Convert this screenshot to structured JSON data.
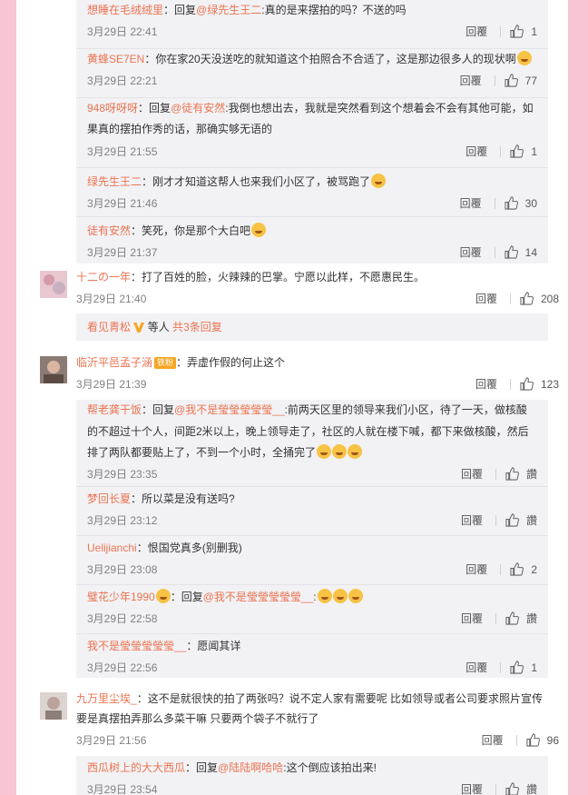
{
  "colors": {
    "accent": "#eb7350",
    "background": "#f7c5d4",
    "sub_bg": "#f2f2f5"
  },
  "icons": {
    "like": "thumbs-up-icon",
    "emoji": "emoji-face-icon",
    "vip": "vip-v-icon"
  },
  "block1": {
    "subs": [
      {
        "name": "想睡在毛绒绒里",
        "sep": "：",
        "prefix": "回复",
        "mention": "@绿先生王二",
        "body": ":真的是来摆拍的吗？不送的吗",
        "emoji": "",
        "time": "3月29日 22:41",
        "reply": "回覆",
        "likes": "1"
      },
      {
        "name": "黄蜂SE7EN",
        "sep": "：",
        "prefix": "",
        "mention": "",
        "body": "你在家20天没送吃的就知道这个拍照合不合适了，这是那边很多人的现状啊",
        "emoji": "emoji-face",
        "time": "3月29日 22:21",
        "reply": "回覆",
        "likes": "77"
      },
      {
        "name": "948呀呀呀",
        "sep": "：",
        "prefix": "回复",
        "mention": "@徒有安然",
        "body": ":我倒也想出去，我就是突然看到这个想着会不会有其他可能，如",
        "body2": "果真的摆拍作秀的话，那确实够无语的",
        "emoji": "",
        "time": "3月29日 21:55",
        "reply": "回覆",
        "likes": "1"
      },
      {
        "name": "绿先生王二",
        "sep": "：",
        "prefix": "",
        "mention": "",
        "body": "刚才才知道这帮人也来我们小区了，被骂跑了",
        "emoji": "emoji-face",
        "time": "3月29日 21:46",
        "reply": "回覆",
        "likes": "30"
      },
      {
        "name": "徒有安然",
        "sep": "：",
        "prefix": "",
        "mention": "",
        "body": "笑死，你是那个大白吧",
        "emoji": "emoji-face",
        "time": "3月29日 21:37",
        "reply": "回覆",
        "likes": "14"
      }
    ]
  },
  "comment1": {
    "name": "十二の一年",
    "sep": "：",
    "body": "打了百姓的脸，火辣辣的巴掌。宁愿以此样，不愿惠民生。",
    "time": "3月29日 21:40",
    "reply": "回覆",
    "likes": "208"
  },
  "more1": {
    "name": "看见青松",
    "mid": " 等人 ",
    "link": "共3条回复"
  },
  "comment2": {
    "name": "临沂平邑孟子涵",
    "badge": "铁粉",
    "sep": "：",
    "body": "弄虚作假的何止这个",
    "time": "3月29日 21:39",
    "reply": "回覆",
    "likes": "123"
  },
  "block2": {
    "subs": [
      {
        "name": "帮老龚干饭",
        "sep": "：",
        "prefix": "回复",
        "mention": "@我不是瑩瑩瑩瑩瑩__",
        "body": ":前两天区里的领导来我们小区，待了一天，做核酸",
        "body2": "的不超过十个人，间距2米以上，晚上领导走了，社区的人就在楼下喊，都下来做核酸，然后",
        "body3": "排了两队都要贴上了，不到一个小时，全捅完了",
        "time": "3月29日 23:35",
        "reply": "回覆",
        "likes": "讚"
      },
      {
        "name": "梦回长夏",
        "sep": "：",
        "prefix": "",
        "mention": "",
        "body": "所以菜是没有送吗?",
        "time": "3月29日 23:12",
        "reply": "回覆",
        "likes": "讚"
      },
      {
        "name": "Uelijianchi",
        "sep": "：",
        "prefix": "",
        "mention": "",
        "body": "恨国党真多(别删我)",
        "time": "3月29日 23:08",
        "reply": "回覆",
        "likes": "2"
      },
      {
        "name": "璧花少年1990",
        "sep": "：",
        "prefix": "回复",
        "mention": "@我不是瑩瑩瑩瑩瑩__",
        "body": ":",
        "time": "3月29日 22:58",
        "reply": "回覆",
        "likes": "讚"
      },
      {
        "name": "我不是瑩瑩瑩瑩瑩__",
        "sep": "：",
        "prefix": "",
        "mention": "",
        "body": "愿闻其详",
        "time": "3月29日 22:56",
        "reply": "回覆",
        "likes": "1"
      }
    ]
  },
  "comment3": {
    "name": "九万里尘埃_",
    "sep": "：",
    "body": "这不是就很快的拍了两张吗？说不定人家有需要呢 比如领导或者公司要求照片宣传",
    "body2": "要是真摆拍弄那么多菜干嘛 只要两个袋子不就行了",
    "time": "3月29日 21:56",
    "reply": "回覆",
    "likes": "96"
  },
  "block3": {
    "subs": [
      {
        "name": "西瓜树上的大大西瓜",
        "sep": "：",
        "prefix": "回复",
        "mention": "@陆陆啊哈哈",
        "body": ":这个倒应该拍出来!",
        "time": "3月29日 23:54",
        "reply": "回覆",
        "likes": "讚"
      }
    ]
  }
}
